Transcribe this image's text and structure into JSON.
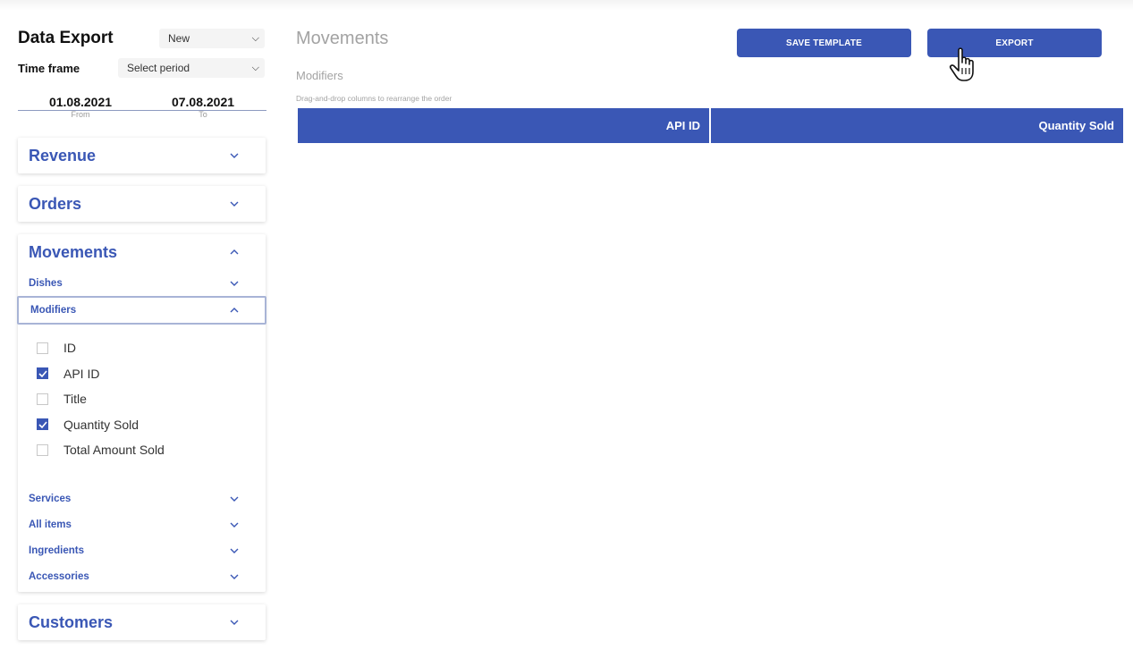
{
  "sidebar": {
    "title": "Data Export",
    "template_select": "New",
    "timeframe_label": "Time frame",
    "period_select": "Select period",
    "date_from": {
      "value": "01.08.2021",
      "caption": "From"
    },
    "date_to": {
      "value": "07.08.2021",
      "caption": "To"
    },
    "sections": {
      "revenue": "Revenue",
      "orders": "Orders",
      "movements": "Movements",
      "customers": "Customers"
    },
    "movements_items": {
      "dishes": "Dishes",
      "modifiers": "Modifiers",
      "services": "Services",
      "all_items": "All items",
      "ingredients": "Ingredients",
      "accessories": "Accessories"
    },
    "modifier_fields": [
      {
        "label": "ID",
        "checked": false
      },
      {
        "label": "API ID",
        "checked": true
      },
      {
        "label": "Title",
        "checked": false
      },
      {
        "label": "Quantity Sold",
        "checked": true
      },
      {
        "label": "Total Amount Sold",
        "checked": false
      }
    ]
  },
  "main": {
    "title": "Movements",
    "subtitle": "Modifiers",
    "hint": "Drag-and-drop columns to rearrange the order",
    "save_button": "SAVE TEMPLATE",
    "export_button": "EXPORT",
    "columns": [
      "API ID",
      "Quantity Sold"
    ]
  },
  "colors": {
    "accent": "#3a57b5",
    "muted_text": "#a3a3a3"
  },
  "icons": {
    "chevron_down": "chevron-down-icon",
    "chevron_up": "chevron-up-icon",
    "checkmark": "checkmark-icon",
    "cursor": "hand-pointer-cursor-icon"
  }
}
